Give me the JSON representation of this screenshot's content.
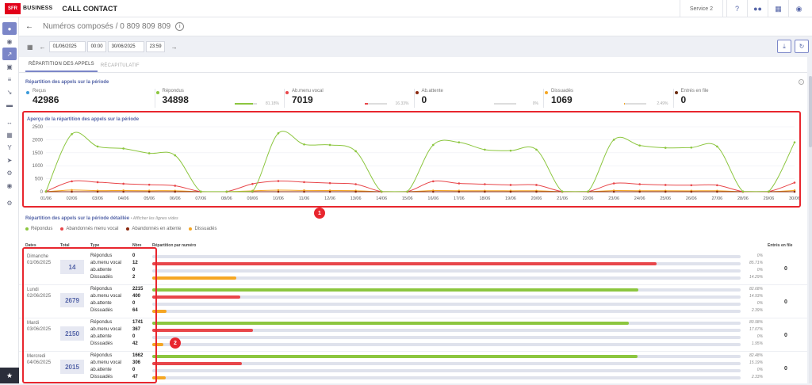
{
  "topbar": {
    "logo": "SFR",
    "brand": "BUSINESS",
    "app_title": "CALL CONTACT",
    "service": "Service 2",
    "icons": [
      "help-icon",
      "team-icon",
      "apps-grid-icon",
      "account-icon"
    ]
  },
  "header": {
    "title": "Numéros composés / 0 809 809 809"
  },
  "date_filter": {
    "start_date": "01/06/2025",
    "start_time": "00:00",
    "end_date": "30/06/2025",
    "end_time": "23:59"
  },
  "tabs": [
    {
      "label": "RÉPARTITION DES APPELS",
      "active": true
    },
    {
      "label": "RÉCAPITULATIF",
      "active": false
    }
  ],
  "summary": {
    "title": "Répartition des appels sur la période",
    "stats": [
      {
        "label": "Reçus",
        "value": "42986",
        "color": "#3a9ad9",
        "pct": "",
        "fill": 0
      },
      {
        "label": "Répondus",
        "value": "34898",
        "color": "#8cc63f",
        "pct": "81.18%",
        "fill": 0.8118
      },
      {
        "label": "Ab.menu vocal",
        "value": "7019",
        "color": "#e8464a",
        "pct": "16.33%",
        "fill": 0.1633
      },
      {
        "label": "Ab.attente",
        "value": "0",
        "color": "#8b2a10",
        "pct": "0%",
        "fill": 0
      },
      {
        "label": "Dissuadés",
        "value": "1069",
        "color": "#f5a623",
        "pct": "2.49%",
        "fill": 0.0249
      },
      {
        "label": "Entrés en file",
        "value": "0",
        "color": "#6b2c10",
        "pct": "",
        "fill": 0
      }
    ]
  },
  "chart_data": {
    "type": "line",
    "title": "Aperçu de la répartition des appels sur la période",
    "categories": [
      "01/06",
      "02/06",
      "03/06",
      "04/06",
      "05/06",
      "06/06",
      "07/06",
      "08/06",
      "09/06",
      "10/06",
      "11/06",
      "12/06",
      "13/06",
      "14/06",
      "15/06",
      "16/06",
      "17/06",
      "18/06",
      "19/06",
      "20/06",
      "21/06",
      "22/06",
      "23/06",
      "24/06",
      "25/06",
      "26/06",
      "27/06",
      "28/06",
      "29/06",
      "30/06"
    ],
    "ylim": [
      0,
      2500
    ],
    "yticks": [
      "0",
      "500",
      "1000",
      "1500",
      "2000",
      "2500"
    ],
    "series": [
      {
        "name": "Répondus",
        "color": "#8cc63f",
        "values": [
          12,
          2215,
          1741,
          1662,
          1480,
          1400,
          5,
          5,
          14,
          2250,
          1820,
          1800,
          1560,
          8,
          8,
          1800,
          1900,
          1620,
          1580,
          1620,
          10,
          10,
          2000,
          1780,
          1690,
          1700,
          1740,
          10,
          10,
          1900
        ]
      },
      {
        "name": "Abandonnés menu vocal",
        "color": "#e8464a",
        "values": [
          12,
          400,
          367,
          306,
          270,
          230,
          5,
          5,
          300,
          410,
          370,
          330,
          290,
          6,
          6,
          400,
          320,
          290,
          260,
          260,
          8,
          8,
          320,
          290,
          260,
          250,
          250,
          8,
          8,
          350
        ]
      },
      {
        "name": "Abandonnés en attente",
        "color": "#8b2a10",
        "values": [
          0,
          0,
          0,
          0,
          0,
          0,
          0,
          0,
          0,
          0,
          0,
          0,
          0,
          0,
          0,
          0,
          0,
          0,
          0,
          0,
          0,
          0,
          0,
          0,
          0,
          0,
          0,
          0,
          0,
          0
        ]
      },
      {
        "name": "Dissuadés",
        "color": "#f5a623",
        "values": [
          2,
          64,
          42,
          47,
          40,
          38,
          0,
          0,
          35,
          60,
          50,
          45,
          40,
          0,
          0,
          45,
          40,
          38,
          36,
          38,
          0,
          0,
          45,
          40,
          38,
          36,
          38,
          0,
          0,
          50
        ]
      }
    ],
    "grid": true,
    "legend": "below"
  },
  "detail": {
    "title": "Répartition des appels sur la période détaillée",
    "hint": "• Afficher les lignes vides",
    "legend": [
      {
        "label": "Répondus",
        "color": "#8cc63f"
      },
      {
        "label": "Abandonnés menu vocal",
        "color": "#e8464a"
      },
      {
        "label": "Abandonnés en attente",
        "color": "#8b2a10"
      },
      {
        "label": "Dissuadés",
        "color": "#f5a623"
      }
    ],
    "columns": {
      "date": "Dates",
      "total": "Total",
      "type": "Type",
      "count": "Nbre",
      "distribution": "Répartition par numéro",
      "queue": "Entrés en file"
    },
    "days": [
      {
        "day": "Dimanche",
        "date": "01/06/2025",
        "total": "14",
        "queue": "0",
        "rows": [
          {
            "type": "Répondus",
            "count": "0",
            "pct": "0%",
            "fill": 0,
            "color": "#8cc63f"
          },
          {
            "type": "ab.menu vocal",
            "count": "12",
            "pct": "85.71%",
            "fill": 0.8571,
            "color": "#e8464a"
          },
          {
            "type": "ab.attente",
            "count": "0",
            "pct": "0%",
            "fill": 0,
            "color": "#8b2a10"
          },
          {
            "type": "Dissuadés",
            "count": "2",
            "pct": "14.29%",
            "fill": 0.1429,
            "color": "#f5a623"
          }
        ]
      },
      {
        "day": "Lundi",
        "date": "02/06/2025",
        "total": "2679",
        "queue": "0",
        "rows": [
          {
            "type": "Répondus",
            "count": "2215",
            "pct": "82.68%",
            "fill": 0.8268,
            "color": "#8cc63f"
          },
          {
            "type": "ab.menu vocal",
            "count": "400",
            "pct": "14.93%",
            "fill": 0.1493,
            "color": "#e8464a"
          },
          {
            "type": "ab.attente",
            "count": "0",
            "pct": "0%",
            "fill": 0,
            "color": "#8b2a10"
          },
          {
            "type": "Dissuadés",
            "count": "64",
            "pct": "2.39%",
            "fill": 0.0239,
            "color": "#f5a623"
          }
        ]
      },
      {
        "day": "Mardi",
        "date": "03/06/2025",
        "total": "2150",
        "queue": "0",
        "rows": [
          {
            "type": "Répondus",
            "count": "1741",
            "pct": "80.98%",
            "fill": 0.8098,
            "color": "#8cc63f"
          },
          {
            "type": "ab.menu vocal",
            "count": "367",
            "pct": "17.07%",
            "fill": 0.1707,
            "color": "#e8464a"
          },
          {
            "type": "ab.attente",
            "count": "0",
            "pct": "0%",
            "fill": 0,
            "color": "#8b2a10"
          },
          {
            "type": "Dissuadés",
            "count": "42",
            "pct": "1.95%",
            "fill": 0.0195,
            "color": "#f5a623"
          }
        ]
      },
      {
        "day": "Mercredi",
        "date": "04/06/2025",
        "total": "2015",
        "queue": "0",
        "rows": [
          {
            "type": "Répondus",
            "count": "1662",
            "pct": "82.48%",
            "fill": 0.8248,
            "color": "#8cc63f"
          },
          {
            "type": "ab.menu vocal",
            "count": "306",
            "pct": "15.19%",
            "fill": 0.1519,
            "color": "#e8464a"
          },
          {
            "type": "ab.attente",
            "count": "0",
            "pct": "0%",
            "fill": 0,
            "color": "#8b2a10"
          },
          {
            "type": "Dissuadés",
            "count": "47",
            "pct": "2.33%",
            "fill": 0.0233,
            "color": "#f5a623"
          }
        ]
      }
    ]
  },
  "annotations": [
    "1",
    "2"
  ]
}
